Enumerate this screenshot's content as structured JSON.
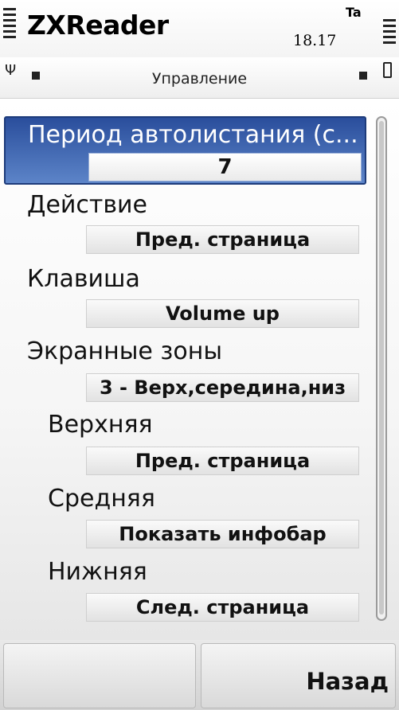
{
  "status_bar": {
    "app_title": "ZXReader",
    "clock": "18.17",
    "indicator_icon": "Ta"
  },
  "navi": {
    "title": "Управление"
  },
  "list": {
    "selected": {
      "title": "Период автолистания (с...",
      "value": "7"
    },
    "items": [
      {
        "title": "Действие",
        "value": "Пред. страница"
      },
      {
        "title": "Клавиша",
        "value": "Volume up"
      },
      {
        "title": "Экранные зоны",
        "value": "3 - Верх,середина,низ"
      },
      {
        "title": "Верхняя",
        "value": "Пред. страница"
      },
      {
        "title": "Средняя",
        "value": "Показать инфобар"
      },
      {
        "title": "Нижняя",
        "value": "След. страница"
      }
    ]
  },
  "softkeys": {
    "left_label": "",
    "right_label": "Назад"
  },
  "colors": {
    "highlight_top": "#2a4e9c",
    "highlight_bottom": "#5c84c8"
  }
}
